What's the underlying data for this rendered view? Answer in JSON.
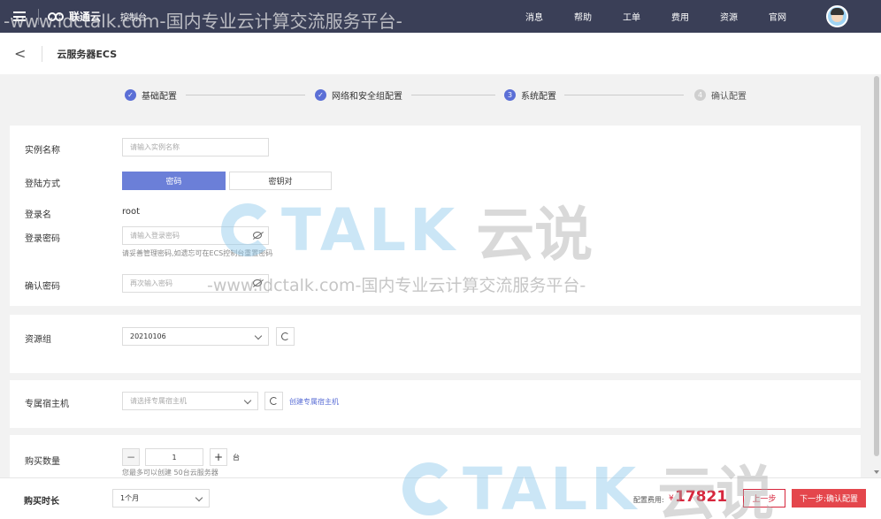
{
  "topbar": {
    "brand": "联通云",
    "console": "控制台",
    "nav": [
      "消息",
      "帮助",
      "工单",
      "费用",
      "资源",
      "官网"
    ]
  },
  "subheader": {
    "back": "<",
    "title": "云服务器ECS"
  },
  "steps": [
    {
      "label": "基础配置",
      "marker": "✓",
      "state": "done"
    },
    {
      "label": "网络和安全组配置",
      "marker": "✓",
      "state": "done"
    },
    {
      "label": "系统配置",
      "marker": "3",
      "state": "active"
    },
    {
      "label": "确认配置",
      "marker": "4",
      "state": "pending"
    }
  ],
  "form": {
    "instance_name": {
      "label": "实例名称",
      "placeholder": "请输入实例名称"
    },
    "login_method": {
      "label": "登陆方式",
      "options": [
        "密码",
        "密钥对"
      ],
      "selected": "密码"
    },
    "login_name": {
      "label": "登录名",
      "value": "root"
    },
    "login_password": {
      "label": "登录密码",
      "placeholder": "请输入登录密码",
      "hint": "请妥善管理密码,如遗忘可在ECS控制台重置密码"
    },
    "confirm_password": {
      "label": "确认密码",
      "placeholder": "再次输入密码"
    },
    "resource_group": {
      "label": "资源组",
      "value": "20210106"
    },
    "dedicated_host": {
      "label": "专属宿主机",
      "placeholder": "请选择专属宿主机",
      "link": "创建专属宿主机"
    },
    "quantity": {
      "label": "购买数量",
      "value": "1",
      "unit": "台",
      "minus": "−",
      "plus": "+",
      "hint": "您最多可以创建 50台云服务器"
    }
  },
  "footer": {
    "duration_label": "购买时长",
    "duration_value": "1个月",
    "fee_label": "配置费用:",
    "fee_symbol": "¥",
    "fee_amount": "17821",
    "prev": "上一步",
    "next": "下一步:确认配置"
  },
  "watermark": {
    "text": "-www.idctalk.com-国内专业云计算交流服务平台-",
    "logo_letters": "TALK",
    "logo_cn": "云说"
  },
  "colors": {
    "primary": "#6b7fd8",
    "danger": "#e4464c",
    "nav_bg": "#3a3f57"
  }
}
